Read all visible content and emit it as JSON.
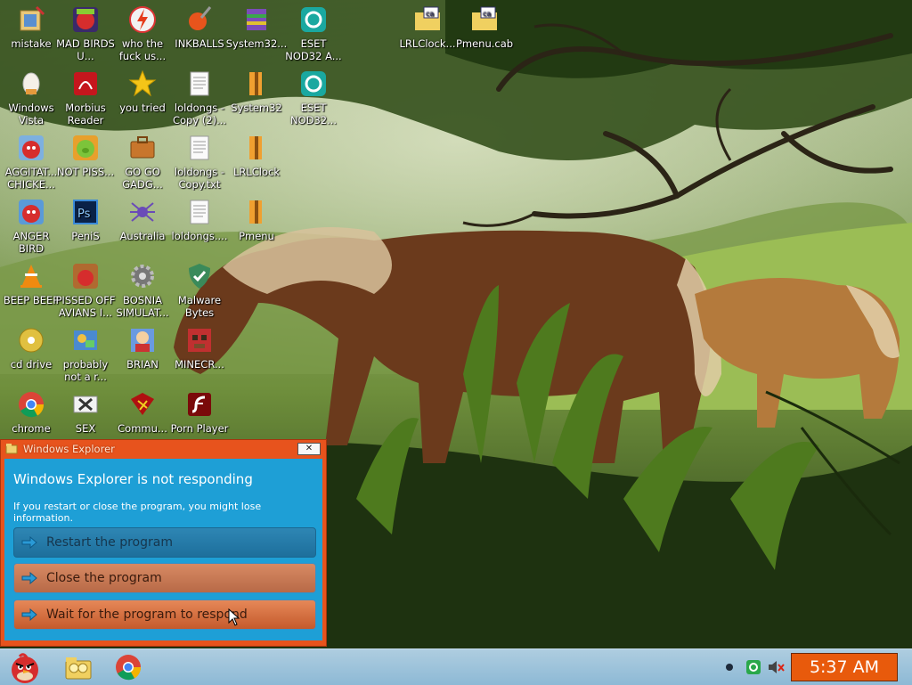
{
  "desktop": {
    "icons": [
      {
        "label": "mistake",
        "icon": "recycle-folder-icon"
      },
      {
        "label": "MAD BIRDS U...",
        "icon": "angry-birds-space-icon"
      },
      {
        "label": "who the fuck us...",
        "icon": "lightning-app-icon"
      },
      {
        "label": "INKBALLS",
        "icon": "paint-ball-icon"
      },
      {
        "label": "System32...",
        "icon": "archive-icon"
      },
      {
        "label": "ESET NOD32 A...",
        "icon": "eset-icon"
      },
      {
        "label": "LRLClock...",
        "icon": "cab-file-icon"
      },
      {
        "label": "Pmenu.cab",
        "icon": "cab-file-icon"
      },
      {
        "label": "Windows Vista",
        "icon": "vista-egg-icon"
      },
      {
        "label": "Morbius Reader",
        "icon": "pdf-reader-icon"
      },
      {
        "label": "you tried",
        "icon": "star-icon"
      },
      {
        "label": "loldongs - Copy (2)...",
        "icon": "text-file-icon"
      },
      {
        "label": "System32",
        "icon": "winrar-icon"
      },
      {
        "label": "ESET NOD32...",
        "icon": "eset-icon"
      },
      {
        "label": "AGGITAT... CHICKE...",
        "icon": "angry-bird-icon"
      },
      {
        "label": "NOT PISS...",
        "icon": "green-pig-icon"
      },
      {
        "label": "GO GO GADG...",
        "icon": "briefcase-icon"
      },
      {
        "label": "loldongs - Copy.txt",
        "icon": "text-file-icon"
      },
      {
        "label": "LRLClock",
        "icon": "winrar-icon"
      },
      {
        "label": "ANGER BIRD",
        "icon": "angry-bird-icon"
      },
      {
        "label": "PeniS",
        "icon": "photoshop-icon"
      },
      {
        "label": "Australia",
        "icon": "spider-icon"
      },
      {
        "label": "loldongs....",
        "icon": "text-file-icon"
      },
      {
        "label": "Pmenu",
        "icon": "winrar-icon"
      },
      {
        "label": "BEEP BEEP",
        "icon": "vlc-cone-icon"
      },
      {
        "label": "PISSED OFF AVIANS I...",
        "icon": "angry-birds-game-icon"
      },
      {
        "label": "BOSNIA SIMULAT...",
        "icon": "gear-icon"
      },
      {
        "label": "Malware Bytes",
        "icon": "shield-icon"
      },
      {
        "label": "cd drive",
        "icon": "cd-drive-icon"
      },
      {
        "label": "probably not a r...",
        "icon": "control-panel-icon"
      },
      {
        "label": "BRIAN",
        "icon": "character-icon"
      },
      {
        "label": "MINECR...",
        "icon": "minecraft-icon"
      },
      {
        "label": "chrome",
        "icon": "chrome-icon"
      },
      {
        "label": "SEX",
        "icon": "xbox-icon"
      },
      {
        "label": "Commu...",
        "icon": "communism-icon"
      },
      {
        "label": "Porn Player",
        "icon": "flash-player-icon"
      }
    ]
  },
  "dialog": {
    "title": "Windows Explorer",
    "close_label": "✕",
    "heading": "Windows Explorer is not responding",
    "description": "If you restart or close the program, you might lose information.",
    "options": [
      "Restart the program",
      "Close the program",
      "Wait for the program to respond"
    ]
  },
  "taskbar": {
    "start_icon": "angry-bird-start-icon",
    "pinned": [
      "explorer-folder-icon",
      "chrome-icon"
    ],
    "tray": [
      "dot-icon",
      "eset-tray-icon",
      "volume-muted-icon"
    ],
    "clock": "5:37 AM"
  },
  "colors": {
    "dialog_frame": "#e7531d",
    "dialog_body": "#1e9fd6",
    "taskbar": "#9fc4dc",
    "clock_bg": "#e85a0c"
  }
}
